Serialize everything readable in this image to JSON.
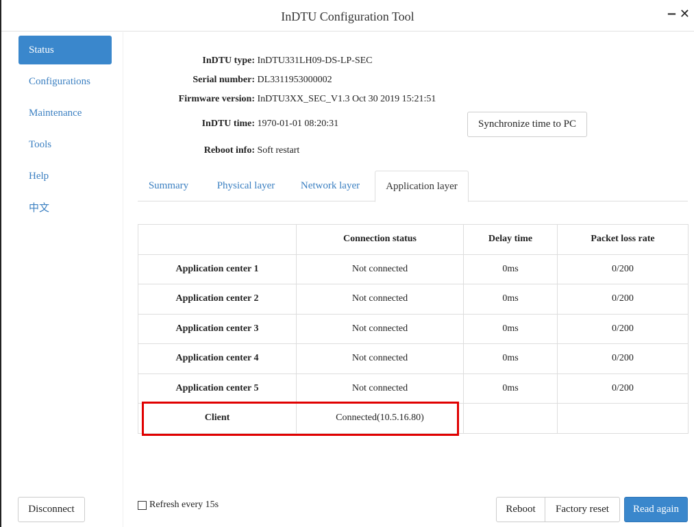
{
  "window": {
    "title": "InDTU Configuration Tool",
    "minimize_glyph": "−",
    "close_glyph": "✕"
  },
  "sidebar": {
    "items": [
      {
        "label": "Status",
        "active": true
      },
      {
        "label": "Configurations"
      },
      {
        "label": "Maintenance"
      },
      {
        "label": "Tools"
      },
      {
        "label": "Help"
      },
      {
        "label": "中文"
      }
    ],
    "disconnect_label": "Disconnect"
  },
  "info": {
    "type_label": "InDTU type:",
    "type_value": "InDTU331LH09-DS-LP-SEC",
    "serial_label": "Serial number:",
    "serial_value": "DL3311953000002",
    "firmware_label": "Firmware version:",
    "firmware_value": "InDTU3XX_SEC_V1.3 Oct 30 2019 15:21:51",
    "time_label": "InDTU time:",
    "time_value": "1970-01-01 08:20:31",
    "reboot_label": "Reboot info:",
    "reboot_value": "Soft restart",
    "sync_button": "Synchronize time to PC"
  },
  "tabs": [
    {
      "label": "Summary"
    },
    {
      "label": "Physical layer"
    },
    {
      "label": "Network layer"
    },
    {
      "label": "Application layer",
      "active": true
    }
  ],
  "table": {
    "headers": [
      "",
      "Connection status",
      "Delay time",
      "Packet loss rate"
    ],
    "rows": [
      [
        "Application center 1",
        "Not connected",
        "0ms",
        "0/200"
      ],
      [
        "Application center 2",
        "Not connected",
        "0ms",
        "0/200"
      ],
      [
        "Application center 3",
        "Not connected",
        "0ms",
        "0/200"
      ],
      [
        "Application center 4",
        "Not connected",
        "0ms",
        "0/200"
      ],
      [
        "Application center 5",
        "Not connected",
        "0ms",
        "0/200"
      ],
      [
        "Client",
        "Connected(10.5.16.80)",
        "",
        ""
      ]
    ]
  },
  "footer": {
    "refresh_label": "Refresh every 15s",
    "reboot_button": "Reboot",
    "factory_reset_button": "Factory reset",
    "read_again_button": "Read again"
  },
  "colors": {
    "accent": "#3a87cc",
    "highlight": "#e00000"
  }
}
